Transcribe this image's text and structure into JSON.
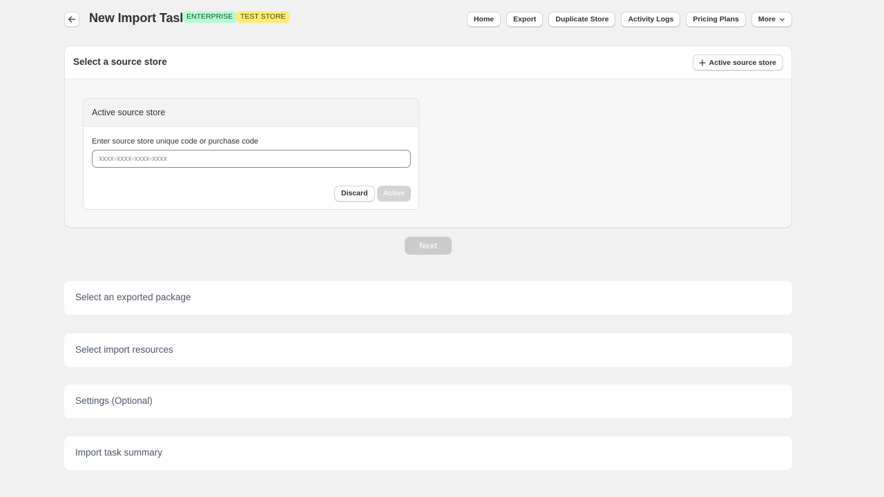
{
  "header": {
    "title": "New Import Task",
    "badges": [
      "ENTERPRISE",
      "TEST STORE"
    ],
    "back_icon": "arrow-left-icon"
  },
  "nav": {
    "items": [
      "Home",
      "Export",
      "Duplicate Store",
      "Activity Logs",
      "Pricing Plans",
      "More"
    ]
  },
  "source_card": {
    "title": "Select a source store",
    "add_button_label": "Active source store",
    "panel": {
      "title": "Active source store",
      "field_label": "Enter source store unique code or purchase code",
      "input_value": "",
      "input_placeholder": "xxxx-xxxx-xxxx-xxxx",
      "discard_label": "Discard",
      "active_label": "Active"
    }
  },
  "next_label": "Next",
  "sections": [
    "Select an exported package",
    "Select import resources",
    "Settings (Optional)",
    "Import task summary"
  ],
  "colors": {
    "page_bg": "#f1f1f1",
    "enterprise_badge_bg": "#b4fed2",
    "test_store_badge_bg": "#ffeb78",
    "disabled_button": "#cbcbcb"
  }
}
